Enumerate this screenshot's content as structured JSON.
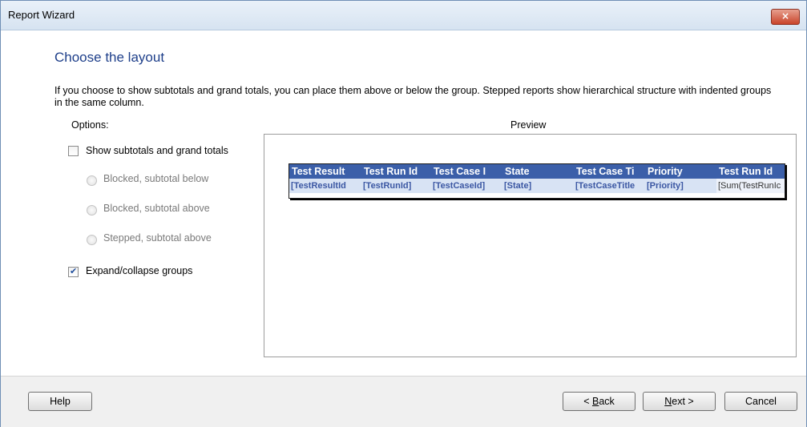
{
  "window": {
    "title": "Report Wizard",
    "close_glyph": "×"
  },
  "page": {
    "heading": "Choose the layout",
    "description": "If you choose to show subtotals and grand totals, you can place them above or below the group. Stepped reports show hierarchical structure with indented groups in the same column."
  },
  "options": {
    "label": "Options:",
    "show_totals": {
      "label": "Show subtotals and grand totals",
      "checked": false
    },
    "radios": [
      {
        "label": "Blocked, subtotal below",
        "enabled": false
      },
      {
        "label": "Blocked, subtotal above",
        "enabled": false
      },
      {
        "label": "Stepped, subtotal above",
        "enabled": false
      }
    ],
    "expand_collapse": {
      "label": "Expand/collapse groups",
      "checked": true
    }
  },
  "preview": {
    "label": "Preview",
    "headers": [
      "Test Result",
      "Test Run Id",
      "Test Case I",
      "State",
      "Test Case Ti",
      "Priority",
      "Test Run Id"
    ],
    "row": [
      "[TestResultId",
      "[TestRunId]",
      "[TestCaseId]",
      "[State]",
      "[TestCaseTitle",
      "[Priority]",
      "[Sum(TestRunIc"
    ]
  },
  "buttons": {
    "help": "Help",
    "back_prefix": "< ",
    "back_key": "B",
    "back_rest": "ack",
    "next_key": "N",
    "next_rest": "ext >",
    "cancel": "Cancel"
  },
  "colors": {
    "header_bg": "#3b5fa9",
    "row_bg": "#d8e3f4",
    "heading": "#1e3f8a"
  }
}
